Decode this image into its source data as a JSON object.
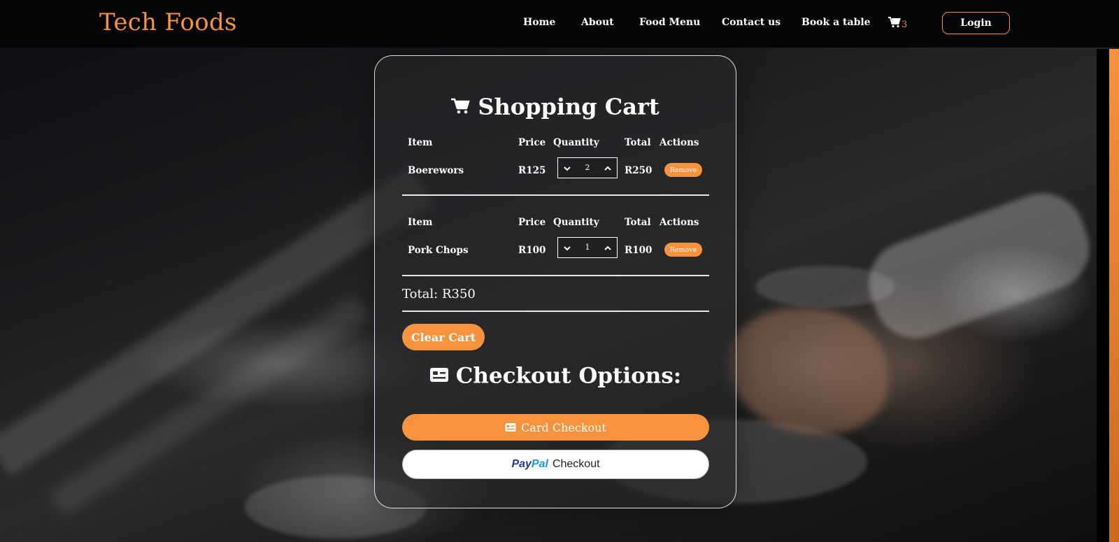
{
  "navbar": {
    "brand": "Tech Foods",
    "links": [
      "Home",
      "About",
      "Food Menu",
      "Contact us",
      "Book a table"
    ],
    "cart_count": "3",
    "login_label": "Login"
  },
  "cart": {
    "title": "Shopping Cart",
    "headers": {
      "item": "Item",
      "price": "Price",
      "quantity": "Quantity",
      "total": "Total",
      "actions": "Actions"
    },
    "rows": [
      {
        "item": "Boerewors",
        "price": "R125",
        "quantity": "2",
        "total": "R250",
        "action": "Remove"
      },
      {
        "item": "Pork Chops",
        "price": "R100",
        "quantity": "1",
        "total": "R100",
        "action": "Remove"
      }
    ],
    "grand_total": "Total: R350",
    "clear_label": "Clear Cart"
  },
  "checkout": {
    "title": "Checkout Options:",
    "card_label": "Card Checkout",
    "paypal_pay": "Pay",
    "paypal_pal": "Pal",
    "paypal_label": "Checkout"
  },
  "colors": {
    "accent": "#f7923d",
    "navbar_bg": "#050505",
    "paypal_dark": "#253b80",
    "paypal_light": "#179bd7"
  },
  "icons": {
    "cart": "shopping-cart-icon",
    "card": "credit-card-icon",
    "chevron_down": "chevron-down-icon",
    "chevron_up": "chevron-up-icon"
  }
}
